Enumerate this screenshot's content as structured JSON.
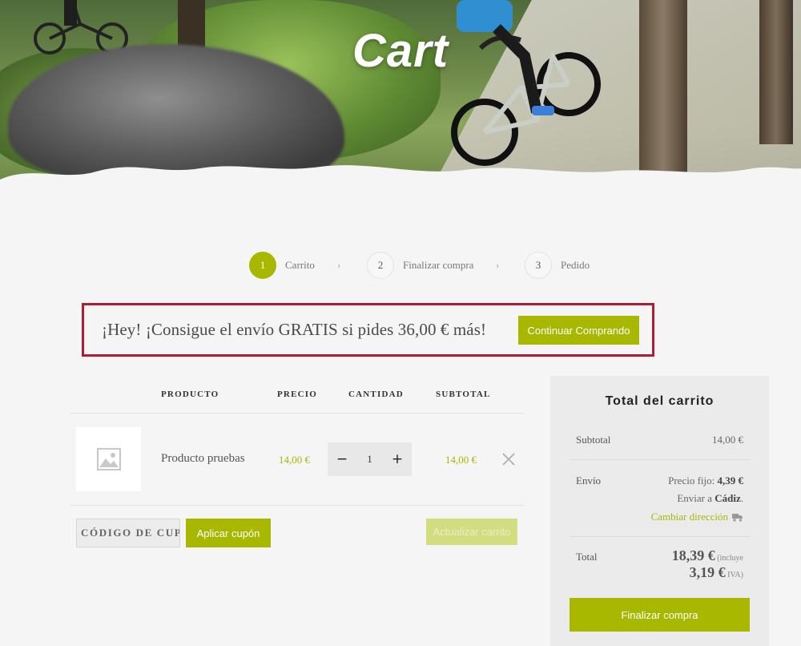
{
  "hero": {
    "title": "Cart"
  },
  "steps": [
    {
      "number": "1",
      "label": "Carrito"
    },
    {
      "number": "2",
      "label": "Finalizar compra"
    },
    {
      "number": "3",
      "label": "Pedido"
    }
  ],
  "notice": {
    "message": "¡Hey! ¡Consigue el envío GRATIS si pides 36,00 € más!",
    "button": "Continuar Comprando"
  },
  "table": {
    "headers": {
      "product": "PRODUCTO",
      "price": "PRECIO",
      "quantity": "CANTIDAD",
      "subtotal": "SUBTOTAL"
    },
    "row": {
      "name": "Producto pruebas",
      "price": "14,00 €",
      "quantity": "1",
      "subtotal": "14,00 €"
    }
  },
  "actions": {
    "coupon_placeholder": "CÓDIGO DE CUPÓN",
    "apply": "Aplicar cupón",
    "update": "Actualizar carrito"
  },
  "totals": {
    "title": "Total del carrito",
    "subtotal_label": "Subtotal",
    "subtotal_value": "14,00 €",
    "shipping_label": "Envío",
    "shipping_rate_prefix": "Precio fijo: ",
    "shipping_rate": "4,39 €",
    "shipping_to_prefix": "Enviar a ",
    "shipping_to": "Cádiz",
    "shipping_to_suffix": ".",
    "change_address": "Cambiar dirección",
    "total_label": "Total",
    "total_value": "18,39 €",
    "tax_prefix": " (incluye",
    "tax_value": "3,19 €",
    "tax_suffix": " IVA)",
    "checkout": "Finalizar compra"
  },
  "colors": {
    "accent": "#a8b800",
    "notice_border": "#b01c35"
  },
  "icons": {
    "thumbnail": "image-placeholder-icon",
    "remove": "close-icon",
    "truck": "truck-icon",
    "step_separator": "chevron-right-icon"
  }
}
